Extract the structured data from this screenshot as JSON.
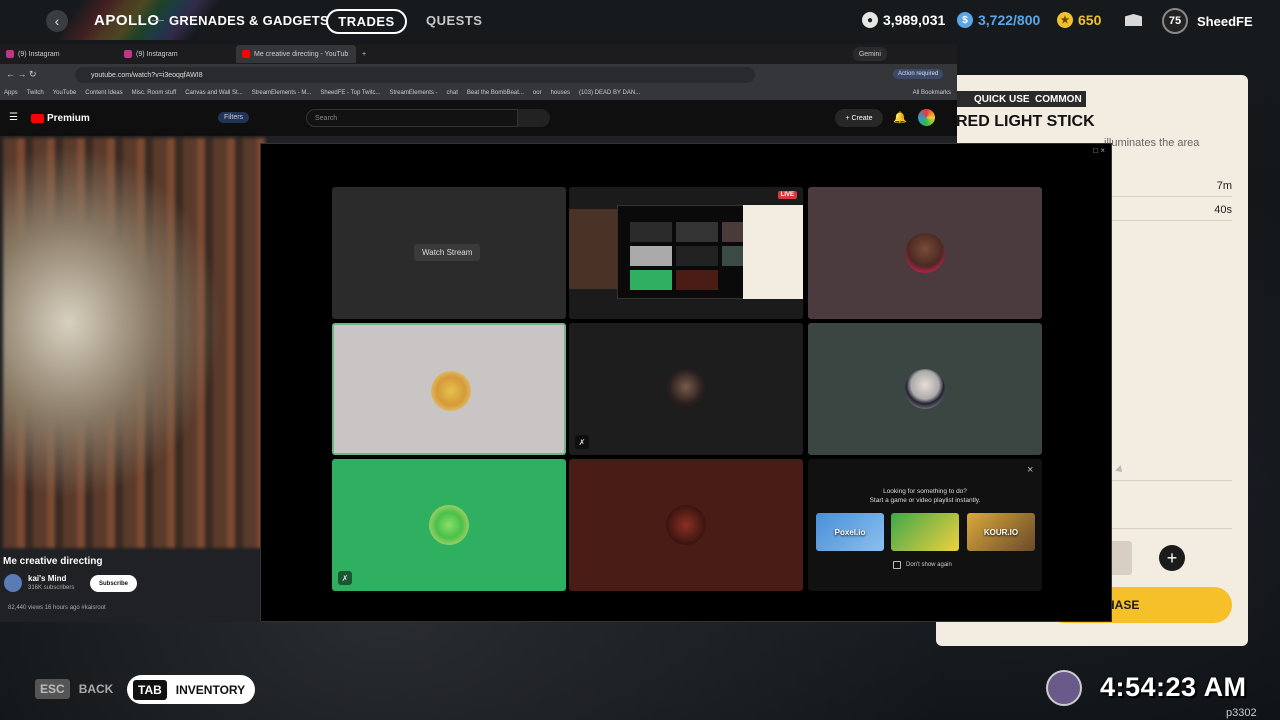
{
  "game": {
    "app_name": "APOLLO",
    "section": "GRENADES & GADGETS",
    "tabs": {
      "trades": "TRADES",
      "quests": "QUESTS"
    },
    "currency": [
      {
        "name": "coins",
        "value": "3,989,031",
        "icon": "coin-icon",
        "color": "#e6e6e6"
      },
      {
        "name": "tokens",
        "value": "3,722/800",
        "icon": "token-icon",
        "color": "#5aa7e8"
      },
      {
        "name": "gold",
        "value": "650",
        "icon": "gold-icon",
        "color": "#f3c030"
      }
    ],
    "level": "75",
    "username": "SheedFE",
    "bottom": {
      "esc_key": "ESC",
      "back": "BACK",
      "tab_key": "TAB",
      "inventory": "INVENTORY"
    },
    "clock": "4:54:23 AM",
    "corner_label": "p3302"
  },
  "item": {
    "tags": [
      "QUICK USE",
      "COMMON"
    ],
    "title": "RED LIGHT STICK",
    "description": "illuminates the area",
    "stats": [
      "7m",
      "40s"
    ],
    "plus": "+",
    "purchase": "HASE"
  },
  "browser": {
    "tabs": [
      {
        "label": "(9) Instagram",
        "color": "#c13584"
      },
      {
        "label": "(9) Instagram",
        "color": "#c13584"
      },
      {
        "label": "Me creative directing - YouTub",
        "color": "#ff0000"
      }
    ],
    "new_tab": "+",
    "gemini": "Gemini",
    "url": "youtube.com/watch?v=i3eoqqfAWI8",
    "action_required": "Action required",
    "bookmarks": [
      "Apps",
      "Twitch",
      "YouTube",
      "Content Ideas",
      "Misc. Room stuff",
      "Canvas and Wall St...",
      "StreamElements - M...",
      "SheedFE - Top Twitc...",
      "StreamElements -",
      "chat",
      "Beat the BombBeat...",
      "oor",
      "houses",
      "(103) DEAD BY DAN...",
      "All Bookmarks"
    ],
    "youtube": {
      "logo": "Premium",
      "filters": "Filters",
      "search_placeholder": "Search",
      "create": "+ Create",
      "video_title": "Me creative directing",
      "channel": "kai's Mind",
      "subscribers": "316K subscribers",
      "subscribe": "Subscribe",
      "views": "82,440 views  16 hours ago  #kaisroot"
    }
  },
  "discord": {
    "watch_stream": "Watch Stream",
    "live": "LIVE",
    "activity_prompt_1": "Looking for something to do?",
    "activity_prompt_2": "Start a game or video playlist instantly.",
    "dont_show": "Don't show again",
    "close": "×",
    "games": [
      {
        "name": "Poxel.io",
        "color": "#4a8fd6"
      },
      {
        "name": "",
        "color": "#3fa84a"
      },
      {
        "name": "KOUR.IO",
        "color": "#d9a93a"
      }
    ]
  }
}
